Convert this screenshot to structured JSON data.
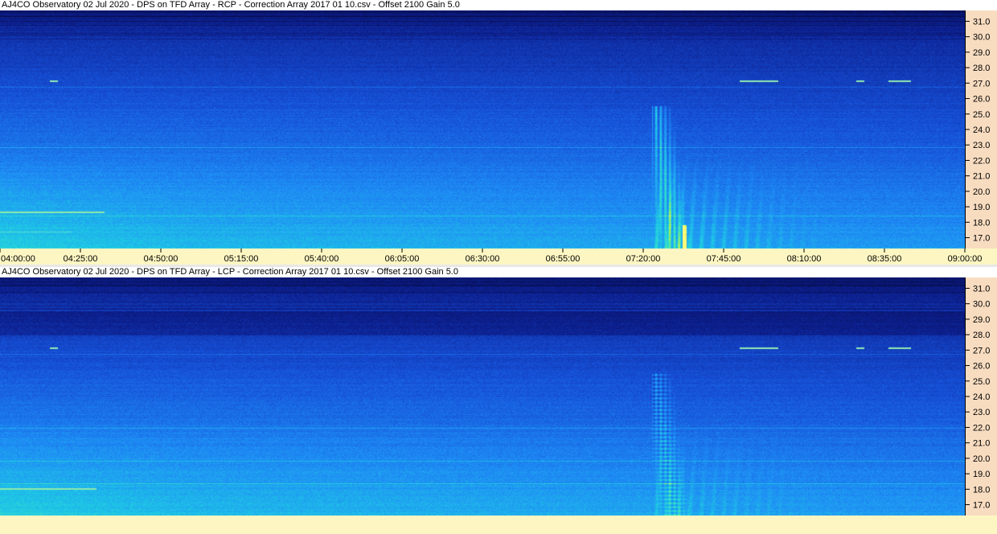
{
  "chart_data": [
    {
      "type": "heatmap",
      "title": "AJ4CO Observatory 02 Jul 2020  -  DPS on TFD Array  -  RCP  -  Correction Array 2017 01 10.csv  -  Offset 2100  Gain 5.0",
      "x_ticks": [
        "04:00:00",
        "04:25:00",
        "04:50:00",
        "05:15:00",
        "05:40:00",
        "06:05:00",
        "06:30:00",
        "06:55:00",
        "07:20:00",
        "07:45:00",
        "08:10:00",
        "08:35:00",
        "09:00:00"
      ],
      "y_ticks": [
        "31.0",
        "30.0",
        "29.0",
        "28.0",
        "27.0",
        "26.0",
        "25.0",
        "24.0",
        "23.0",
        "22.0",
        "21.0",
        "20.0",
        "19.0",
        "18.0",
        "17.0"
      ],
      "xlim": [
        "04:00:00",
        "09:00:00"
      ],
      "ylim": [
        16.3,
        31.7
      ],
      "colors": {
        "low": "#0a1a6e",
        "mid": "#1e6ee8",
        "high": "#28d8c8",
        "peak": "#e6f020",
        "freq_axis_bg": "#f8dcc0",
        "time_axis_bg": "#fef6c2"
      }
    },
    {
      "type": "heatmap",
      "title": "AJ4CO Observatory 02 Jul 2020  -  DPS on TFD Array  -  LCP  -  Correction Array 2017 01 10.csv  -  Offset 2100  Gain 5.0",
      "x_ticks": [],
      "y_ticks": [
        "31.0",
        "30.0",
        "29.0",
        "28.0",
        "27.0",
        "26.0",
        "25.0",
        "24.0",
        "23.0",
        "22.0",
        "21.0",
        "20.0",
        "19.0",
        "18.0",
        "17.0"
      ],
      "xlim": [
        "04:00:00",
        "09:00:00"
      ],
      "ylim": [
        16.3,
        31.7
      ],
      "colors": {
        "low": "#0a1a6e",
        "mid": "#1e6ee8",
        "high": "#28d8c8",
        "peak": "#e6f020",
        "freq_axis_bg": "#f8dcc0",
        "time_axis_bg": "#fef6c2"
      }
    }
  ]
}
